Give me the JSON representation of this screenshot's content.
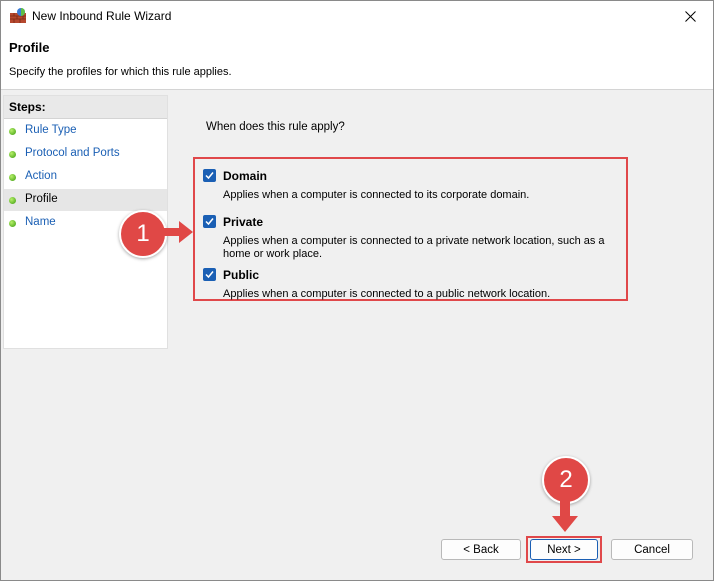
{
  "window": {
    "title": "New Inbound Rule Wizard",
    "close_icon": "close-icon",
    "app_icon": "firewall-icon"
  },
  "header": {
    "title": "Profile",
    "subtitle": "Specify the profiles for which this rule applies."
  },
  "steps": {
    "heading": "Steps:",
    "items": [
      {
        "label": "Rule Type",
        "active": false
      },
      {
        "label": "Protocol and Ports",
        "active": false
      },
      {
        "label": "Action",
        "active": false
      },
      {
        "label": "Profile",
        "active": true
      },
      {
        "label": "Name",
        "active": false
      }
    ]
  },
  "main": {
    "question": "When does this rule apply?",
    "options": [
      {
        "label": "Domain",
        "checked": true,
        "description": "Applies when a computer is connected to its corporate domain."
      },
      {
        "label": "Private",
        "checked": true,
        "description": "Applies when a computer is connected to a private network location, such as a home or work place."
      },
      {
        "label": "Public",
        "checked": true,
        "description": "Applies when a computer is connected to a public network location."
      }
    ]
  },
  "annotations": {
    "badge1": "1",
    "badge2": "2",
    "highlight_color": "#e0484a"
  },
  "buttons": {
    "back": "< Back",
    "next": "Next >",
    "cancel": "Cancel"
  },
  "colors": {
    "accent": "#1a5fb4",
    "annotation_red": "#e04846"
  }
}
